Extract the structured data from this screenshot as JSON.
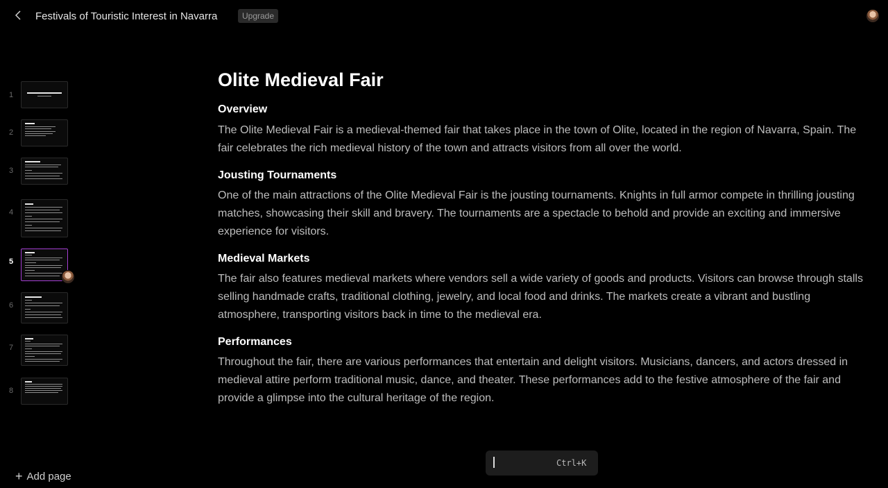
{
  "header": {
    "title": "Festivals of Touristic Interest in Navarra",
    "upgrade_label": "Upgrade",
    "back_icon": "chevron-left-icon",
    "avatar_icon": "user-avatar-icon"
  },
  "sidebar": {
    "pages": [
      {
        "number": "1"
      },
      {
        "number": "2"
      },
      {
        "number": "3"
      },
      {
        "number": "4"
      },
      {
        "number": "5"
      },
      {
        "number": "6"
      },
      {
        "number": "7"
      },
      {
        "number": "8"
      }
    ],
    "active_page": "5",
    "add_page_label": "Add page"
  },
  "content": {
    "title": "Olite Medieval Fair",
    "sections": [
      {
        "heading": "Overview",
        "body": "The Olite Medieval Fair is a medieval-themed fair that takes place in the town of Olite, located in the region of Navarra, Spain. The fair celebrates the rich medieval history of the town and attracts visitors from all over the world."
      },
      {
        "heading": "Jousting Tournaments",
        "body": "One of the main attractions of the Olite Medieval Fair is the jousting tournaments. Knights in full armor compete in thrilling jousting matches, showcasing their skill and bravery. The tournaments are a spectacle to behold and provide an exciting and immersive experience for visitors."
      },
      {
        "heading": "Medieval Markets",
        "body": "The fair also features medieval markets where vendors sell a wide variety of goods and products. Visitors can browse through stalls selling handmade crafts, traditional clothing, jewelry, and local food and drinks. The markets create a vibrant and bustling atmosphere, transporting visitors back in time to the medieval era."
      },
      {
        "heading": "Performances",
        "body": "Throughout the fair, there are various performances that entertain and delight visitors. Musicians, dancers, and actors dressed in medieval attire perform traditional music, dance, and theater. These performances add to the festive atmosphere of the fair and provide a glimpse into the cultural heritage of the region."
      }
    ]
  },
  "command": {
    "value": "",
    "shortcut": "Ctrl+K"
  },
  "colors": {
    "background": "#000000",
    "active_thumb_border": "#a43fd2",
    "body_text": "#bdbdbd"
  }
}
